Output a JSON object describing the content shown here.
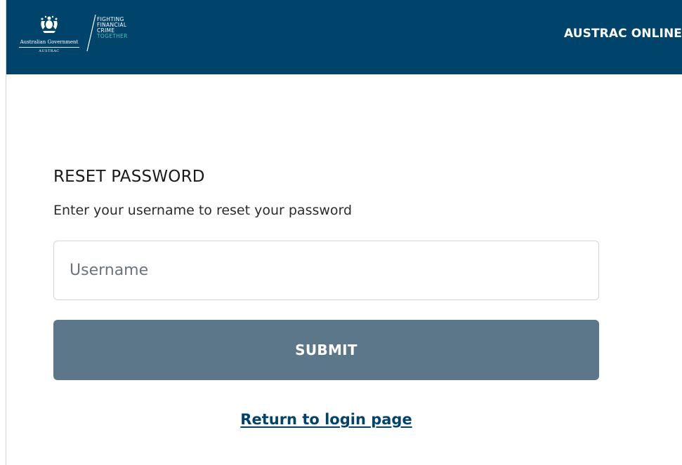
{
  "header": {
    "gov_name": "Australian Government",
    "gov_agency": "AUSTRAC",
    "tagline": {
      "line1": "FIGHTING",
      "line2": "FINANCIAL",
      "line3": "CRIME",
      "line4": "TOGETHER"
    },
    "app_title": "AUSTRAC ONLINE"
  },
  "form": {
    "title": "RESET PASSWORD",
    "subtitle": "Enter your username to reset your password",
    "username_placeholder": "Username",
    "username_value": "",
    "submit_label": "SUBMIT",
    "return_link": "Return to login page"
  },
  "colors": {
    "header_bg": "#00446b",
    "button_bg": "#5b7789",
    "link": "#00446b",
    "tagline_accent": "#45c4b0"
  },
  "icons": {
    "crest": "coat-of-arms-icon",
    "slash": "slash-divider-icon"
  }
}
